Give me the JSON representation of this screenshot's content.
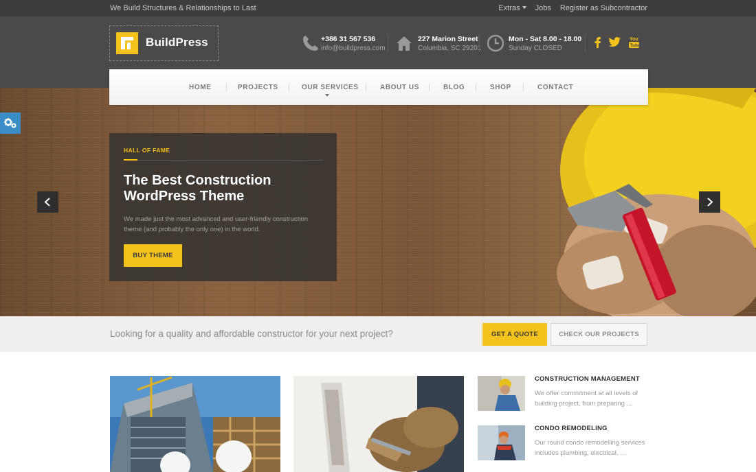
{
  "topbar": {
    "tagline": "We Build Structures & Relationships to Last",
    "links": [
      "Extras",
      "Jobs",
      "Register as Subcontractor"
    ]
  },
  "brand": {
    "name": "BuildPress"
  },
  "contact": {
    "phone": {
      "line1": "+386 31 567 536",
      "line2": "info@buildpress.com",
      "icon": "phone-icon"
    },
    "address": {
      "line1": "227 Marion Street",
      "line2": "Columbia, SC 29201",
      "icon": "home-icon"
    },
    "hours": {
      "line1": "Mon - Sat 8.00 - 18.00",
      "line2": "Sunday CLOSED",
      "icon": "clock-icon"
    }
  },
  "social": [
    "facebook-icon",
    "twitter-icon",
    "youtube-icon"
  ],
  "nav": {
    "items": [
      "HOME",
      "PROJECTS",
      "OUR SERVICES",
      "ABOUT US",
      "BLOG",
      "SHOP",
      "CONTACT"
    ]
  },
  "hero": {
    "kicker": "HALL OF FAME",
    "title": "The Best Construction WordPress Theme",
    "text": "We made just the most advanced and user-friendly construction theme (and probably the only one) in the world.",
    "button": "BUY THEME"
  },
  "cta": {
    "text": "Looking for a quality and affordable constructor for your next project?",
    "quote_button": "GET A QUOTE",
    "projects_button": "CHECK OUR PROJECTS"
  },
  "services": [
    {
      "title": "CONSTRUCTION MANAGEMENT",
      "desc": "We offer commitment at all levels of building project, from preparing …"
    },
    {
      "title": "CONDO REMODELING",
      "desc": "Our round condo remodelling services includes plumbing, electrical, …"
    }
  ],
  "colors": {
    "accent": "#f4c21a",
    "header": "#4a4a4a",
    "topbar": "#3d3d3d",
    "gear_tab": "#3b8dc7"
  }
}
